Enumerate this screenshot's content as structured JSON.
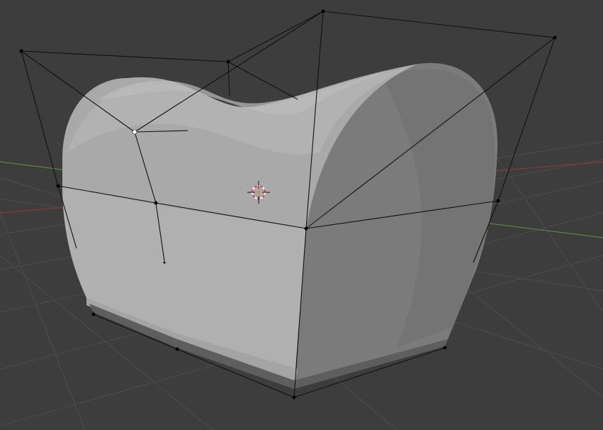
{
  "viewport": {
    "background": "#3d3d3d",
    "grid_color": "#4a4a4a",
    "axis_x_color": "#8a3a3a",
    "axis_y_color": "#5a8a3a",
    "cage_color": "#111111",
    "vertex_color": "#000000",
    "active_vertex_color": "#ffffff",
    "mesh_front_color": "#b0b0b0",
    "mesh_side_color": "#7e7e7e",
    "mesh_top_color": "#a8a8a8",
    "cursor_colors": [
      "#e04040",
      "#ffffff"
    ]
  },
  "objects": {
    "mesh": "deformed-mesh",
    "cage": "lattice-cage",
    "cursor": "3d-cursor-icon"
  }
}
